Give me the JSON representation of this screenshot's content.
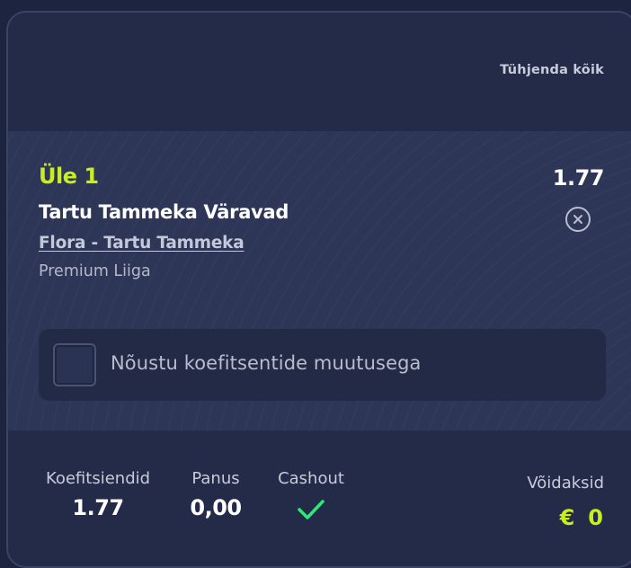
{
  "header": {
    "clear_all_label": "Tühjenda kõik"
  },
  "bet": {
    "selection": "Üle 1",
    "odds": "1.77",
    "market": "Tartu Tammeka Väravad",
    "event": "Flora - Tartu Tammeka",
    "league": "Premium Liiga",
    "accept_odds_label": "Nõustu koefitsentide muutusega",
    "accept_odds_checked": false
  },
  "summary": {
    "odds_label": "Koefitsiendid",
    "odds_value": "1.77",
    "stake_label": "Panus",
    "stake_value": "0,00",
    "cashout_label": "Cashout",
    "cashout_icon": "check-icon",
    "win_label": "Võidaksid",
    "win_currency": "€",
    "win_value": "0"
  },
  "colors": {
    "accent": "#c8ee1e",
    "check": "#2ee87a",
    "background": "#232b48",
    "bet_background": "#2e3658"
  }
}
